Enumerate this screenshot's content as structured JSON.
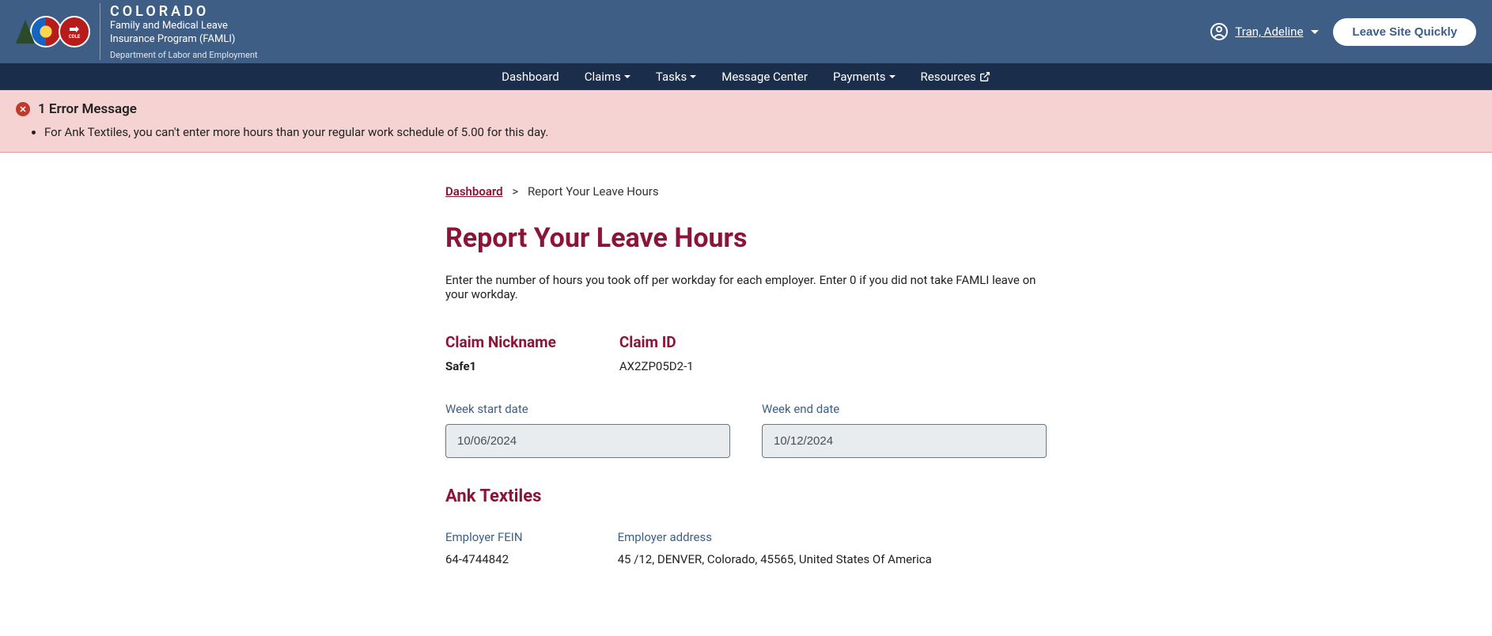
{
  "header": {
    "state": "COLORADO",
    "program_line1": "Family and Medical Leave",
    "program_line2": "Insurance Program (FAMLI)",
    "department": "Department of Labor and Employment",
    "cdle_label": "CDLE",
    "user_name": "Tran, Adeline",
    "leave_button": "Leave Site Quickly"
  },
  "nav": {
    "dashboard": "Dashboard",
    "claims": "Claims",
    "tasks": "Tasks",
    "message_center": "Message Center",
    "payments": "Payments",
    "resources": "Resources"
  },
  "error": {
    "title": "1 Error Message",
    "items": [
      "For Ank Textiles, you can't enter more hours than your regular work schedule of 5.00 for this day."
    ]
  },
  "breadcrumb": {
    "dashboard": "Dashboard",
    "current": "Report Your Leave Hours"
  },
  "page": {
    "title": "Report Your Leave Hours",
    "instructions": "Enter the number of hours you took off per workday for each employer. Enter 0 if you did not take FAMLI leave on your workday."
  },
  "claim": {
    "nickname_label": "Claim Nickname",
    "nickname_value": "Safe1",
    "id_label": "Claim ID",
    "id_value": "AX2ZP05D2-1"
  },
  "dates": {
    "start_label": "Week start date",
    "start_value": "10/06/2024",
    "end_label": "Week end date",
    "end_value": "10/12/2024"
  },
  "employer": {
    "name": "Ank Textiles",
    "fein_label": "Employer FEIN",
    "fein_value": "64-4744842",
    "address_label": "Employer address",
    "address_value": "45 /12, DENVER, Colorado, 45565, United States Of America"
  }
}
